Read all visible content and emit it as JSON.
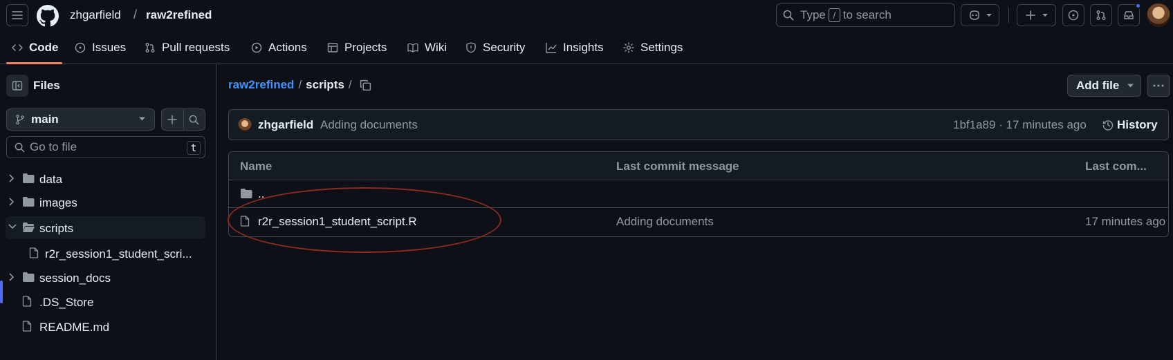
{
  "header": {
    "owner": "zhgarfield",
    "separator": "/",
    "repo": "raw2refined",
    "search_prefix": "Type",
    "search_key": "/",
    "search_suffix": "to search"
  },
  "tabs": [
    {
      "label": "Code",
      "icon": "code-icon"
    },
    {
      "label": "Issues",
      "icon": "issue-opened-icon"
    },
    {
      "label": "Pull requests",
      "icon": "git-pull-request-icon"
    },
    {
      "label": "Actions",
      "icon": "play-icon"
    },
    {
      "label": "Projects",
      "icon": "table-icon"
    },
    {
      "label": "Wiki",
      "icon": "book-icon"
    },
    {
      "label": "Security",
      "icon": "shield-icon"
    },
    {
      "label": "Insights",
      "icon": "graph-icon"
    },
    {
      "label": "Settings",
      "icon": "gear-icon"
    }
  ],
  "sidebar": {
    "title": "Files",
    "branch": "main",
    "goto_placeholder": "Go to file",
    "goto_key": "t",
    "tree": [
      {
        "label": "data",
        "type": "folder"
      },
      {
        "label": "images",
        "type": "folder"
      },
      {
        "label": "scripts",
        "type": "folder-open"
      },
      {
        "label": "r2r_session1_student_scri...",
        "type": "file"
      },
      {
        "label": "session_docs",
        "type": "folder"
      },
      {
        "label": ".DS_Store",
        "type": "file"
      },
      {
        "label": "README.md",
        "type": "file"
      }
    ]
  },
  "main": {
    "breadcrumb_root": "raw2refined",
    "breadcrumb_sep": "/",
    "breadcrumb_current": "scripts",
    "breadcrumb_trail": "/",
    "add_file": "Add file",
    "commit": {
      "author": "zhgarfield",
      "message": "Adding documents",
      "meta": "1bf1a89 · 17 minutes ago",
      "history": "History"
    },
    "table": {
      "headers": {
        "name": "Name",
        "message": "Last commit message",
        "date": "Last com..."
      },
      "parent_dir": "..",
      "rows": [
        {
          "name": "r2r_session1_student_script.R",
          "message": "Adding documents",
          "date": "17 minutes ago"
        }
      ]
    }
  },
  "colors": {
    "accent_link": "#4493f8",
    "tab_underline": "#f78166",
    "selection_bar": "#4f6af7",
    "annotation": "#8f2a22"
  }
}
